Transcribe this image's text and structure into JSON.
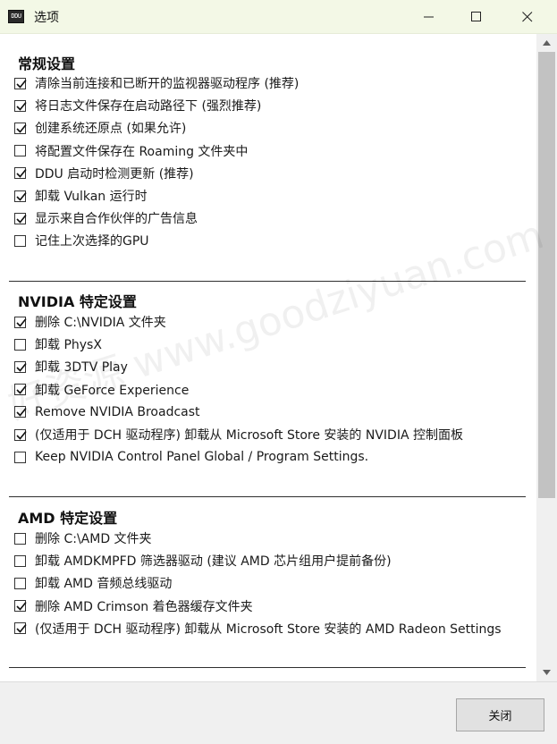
{
  "window": {
    "title": "选项",
    "app_icon_text": "DDU"
  },
  "sections": {
    "general": {
      "title": "常规设置",
      "items": [
        {
          "label": "清除当前连接和已断开的监视器驱动程序 (推荐)",
          "checked": true
        },
        {
          "label": "将日志文件保存在启动路径下 (强烈推荐)",
          "checked": true
        },
        {
          "label": "创建系统还原点 (如果允许)",
          "checked": true
        },
        {
          "label": "将配置文件保存在 Roaming 文件夹中",
          "checked": false
        },
        {
          "label": "DDU 启动时检测更新 (推荐)",
          "checked": true
        },
        {
          "label": "卸载 Vulkan 运行时",
          "checked": true
        },
        {
          "label": "显示来自合作伙伴的广告信息",
          "checked": true
        },
        {
          "label": "记住上次选择的GPU",
          "checked": false
        }
      ]
    },
    "nvidia": {
      "title": "NVIDIA 特定设置",
      "items": [
        {
          "label": "删除 C:\\NVIDIA 文件夹",
          "checked": true
        },
        {
          "label": "卸载 PhysX",
          "checked": false
        },
        {
          "label": "卸载 3DTV Play",
          "checked": true
        },
        {
          "label": "卸载 GeForce Experience",
          "checked": true
        },
        {
          "label": "Remove NVIDIA Broadcast",
          "checked": true
        },
        {
          "label": "(仅适用于 DCH 驱动程序) 卸载从 Microsoft Store 安装的 NVIDIA 控制面板",
          "checked": true
        },
        {
          "label": "Keep NVIDIA Control Panel Global / Program Settings.",
          "checked": false
        }
      ]
    },
    "amd": {
      "title": "AMD 特定设置",
      "items": [
        {
          "label": "删除 C:\\AMD 文件夹",
          "checked": false
        },
        {
          "label": "卸载 AMDKMPFD 筛选器驱动 (建议 AMD 芯片组用户提前备份)",
          "checked": false
        },
        {
          "label": "卸载 AMD 音频总线驱动",
          "checked": false
        },
        {
          "label": "删除 AMD Crimson 着色器缓存文件夹",
          "checked": true
        },
        {
          "label": "(仅适用于 DCH 驱动程序) 卸载从 Microsoft Store 安装的 AMD Radeon Settings",
          "checked": true
        }
      ]
    }
  },
  "footer": {
    "close_label": "关闭"
  },
  "watermark": "好资源 www.goodziyuan.com"
}
